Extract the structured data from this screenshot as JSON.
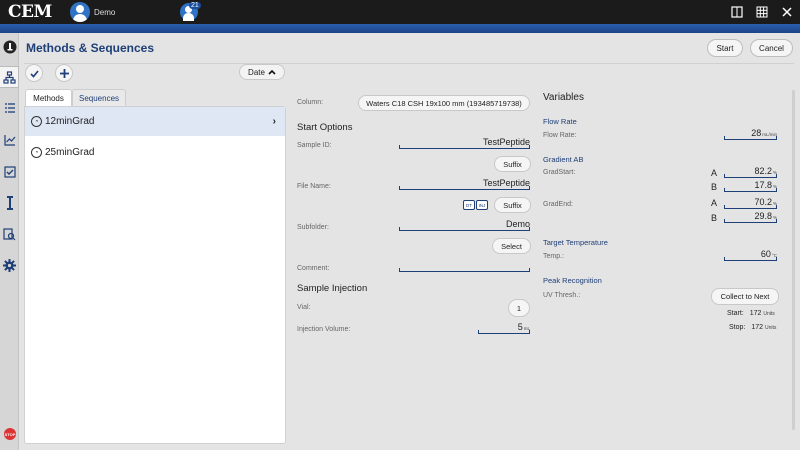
{
  "header": {
    "logo": "CEM",
    "user_name": "Demo",
    "notification_count": "21"
  },
  "page": {
    "title": "Methods & Sequences",
    "start_label": "Start",
    "cancel_label": "Cancel"
  },
  "list": {
    "sort_label": "Date",
    "tabs": [
      {
        "label": "Methods",
        "active": true
      },
      {
        "label": "Sequences",
        "active": false
      }
    ],
    "items": [
      {
        "label": "12minGrad",
        "selected": true
      },
      {
        "label": "25minGrad",
        "selected": false
      }
    ]
  },
  "form": {
    "column_label": "Column:",
    "column_value": "Waters C18 CSH 19x100 mm (193485719738)",
    "start_options_title": "Start Options",
    "sample_id_label": "Sample ID:",
    "sample_id_value": "TestPeptide",
    "suffix_label": "Suffix",
    "file_name_label": "File Name:",
    "file_name_value": "TestPeptide",
    "dt_label": "DT",
    "inj_label": "INJ",
    "subfolder_label": "Subfolder:",
    "subfolder_value": "Demo",
    "select_label": "Select",
    "comment_label": "Comment:",
    "comment_value": "",
    "sample_injection_title": "Sample Injection",
    "vial_label": "Vial:",
    "vial_value": "1",
    "injection_volume_label": "Injection Volume:",
    "injection_volume_value": "5",
    "injection_volume_unit": "mL"
  },
  "variables": {
    "title": "Variables",
    "flow_rate_title": "Flow Rate",
    "flow_rate_label": "Flow Rate:",
    "flow_rate_value": "28",
    "flow_rate_unit": "mL/min",
    "gradient_title": "Gradient AB",
    "grad_start_label": "GradStart:",
    "grad_start_a": "82.2",
    "grad_start_b": "17.8",
    "grad_end_label": "GradEnd:",
    "grad_end_a": "70.2",
    "grad_end_b": "29.8",
    "percent_unit": "%",
    "a_label": "A",
    "b_label": "B",
    "target_temp_title": "Target Temperature",
    "temp_label": "Temp.:",
    "temp_value": "60",
    "temp_unit": "°C",
    "peak_title": "Peak Recognition",
    "uv_thresh_label": "UV Thresh.:",
    "collect_label": "Collect to Next",
    "start_label": "Start:",
    "start_value": "172",
    "stop_label": "Stop:",
    "stop_value": "172",
    "units_label": "Units"
  },
  "colors": {
    "topbar": "#1b1b1b",
    "blue_band": "#2a5fad",
    "accent": "#1f3f77",
    "selected_row": "#dfe7f5",
    "stop": "#dd3333"
  },
  "icons": {
    "rail": [
      "info-icon",
      "methods-tree-icon",
      "list-icon",
      "chart-icon",
      "checklist-icon",
      "column-icon",
      "search-doc-icon",
      "gear-icon",
      "stop-icon"
    ]
  }
}
